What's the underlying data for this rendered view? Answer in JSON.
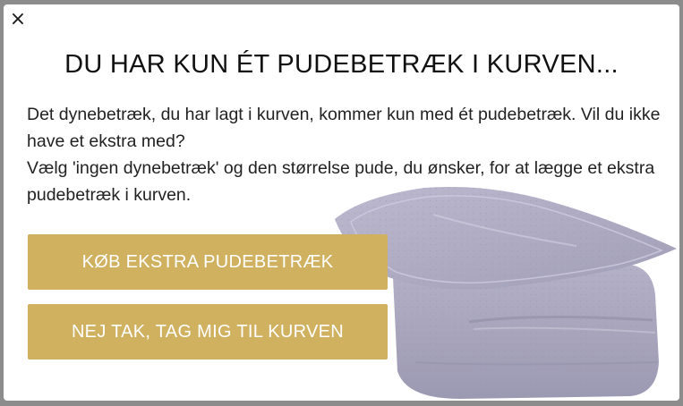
{
  "modal": {
    "close_symbol": "×",
    "title": "DU HAR KUN ÉT PUDEBETRÆK I KURVEN...",
    "body_line_1": "Det dynebetræk, du har lagt i kurven, kommer kun med ét pudebetræk. Vil du ikke have et ekstra med?",
    "body_line_2": "Vælg 'ingen dynebetræk' og den størrelse pude, du ønsker, for at lægge et ekstra pudebetræk i kurven.",
    "buy_extra_label": "KØB EKSTRA PUDEBETRÆK",
    "no_thanks_label": "NEJ TAK, TAG MIG TIL KURVEN"
  },
  "colors": {
    "button_gold": "#d0b160",
    "bedding_lavender": "#a9a6bd"
  }
}
